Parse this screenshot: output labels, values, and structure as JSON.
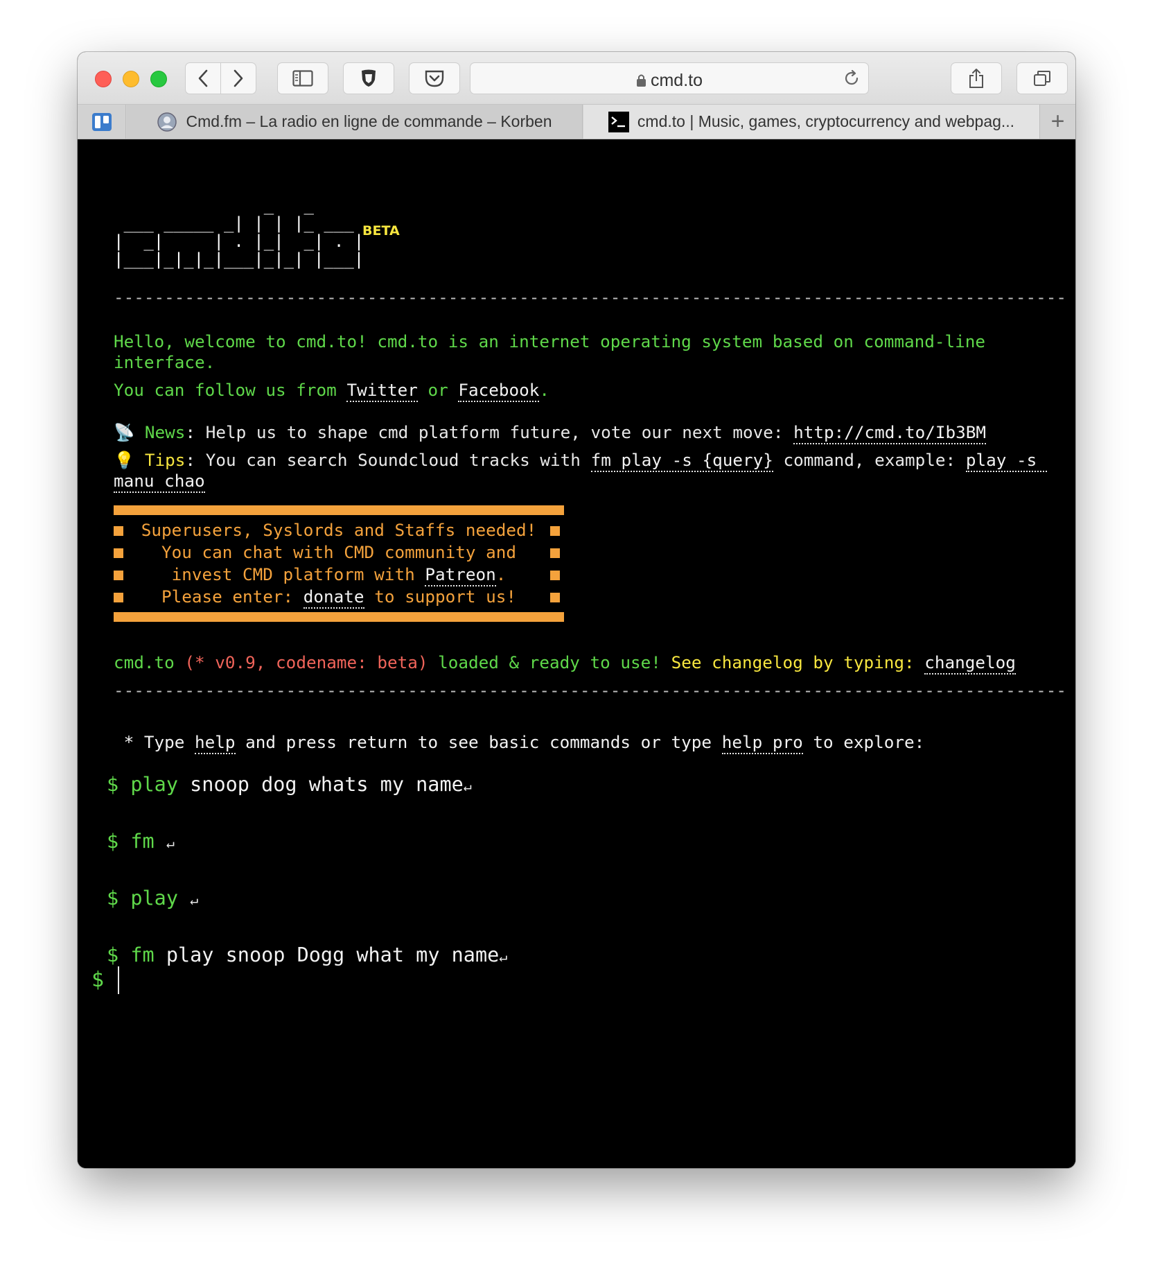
{
  "browser": {
    "url": "cmd.to",
    "tabs": [
      {
        "label": "Cmd.fm – La radio en ligne de commande – Korben"
      },
      {
        "label": "cmd.to | Music, games, cryptocurrency and webpag..."
      }
    ],
    "new_tab_label": "+"
  },
  "terminal": {
    "ascii_logo": [
      "               _   _",
      " ___ _____ _| | | |_ ___",
      "|  _|     | . |_|  _| . |",
      "|___|_|_|_|___|_|_| |___|"
    ],
    "beta_label": "BETA",
    "divider": "----------------------------------------------------------------------------------------------",
    "welcome": {
      "line1": "Hello, welcome to cmd.to! cmd.to is an internet operating system based on command-line",
      "line2": "interface.",
      "follow_prefix": "You can follow us from ",
      "twitter": "Twitter",
      "or": " or ",
      "facebook": "Facebook",
      "period": "."
    },
    "news": {
      "icon": "📡",
      "label": "News",
      "colon": ": ",
      "text": "Help us to shape cmd platform future, vote our next move: ",
      "link": "http://cmd.to/Ib3BM"
    },
    "tips": {
      "icon": "💡",
      "label": "Tips",
      "colon": ": ",
      "text1": "You can search Soundcloud tracks with ",
      "cmd": "fm play -s {query}",
      "text2": " command, example: ",
      "example1": "play -s ",
      "example2": "manu chao"
    },
    "banner": {
      "line1": "Superusers, Syslords and Staffs needed!",
      "line2": "You can chat with CMD community and",
      "line3_prefix": "invest CMD platform with ",
      "patreon": "Patreon",
      "line3_suffix": ".",
      "line4_prefix": "Please enter: ",
      "donate": "donate",
      "line4_suffix": " to support us!"
    },
    "status": {
      "name": "cmd.to ",
      "version": "(* v0.9, codename: beta)",
      "loaded": " loaded & ready to use! ",
      "see": "See changelog by typing: ",
      "changelog": "changelog"
    },
    "help": {
      "prefix": " * Type ",
      "help": "help",
      "middle": " and press return to see basic commands or type ",
      "help_pro": "help pro",
      "suffix": " to explore:"
    },
    "commands": [
      {
        "prompt": "$",
        "cmd": "play",
        "args": " snoop dog whats my name",
        "ret": "↵"
      },
      {
        "prompt": "$",
        "cmd": "fm",
        "args": " ",
        "ret": "↵"
      },
      {
        "prompt": "$",
        "cmd": "play",
        "args": " ",
        "ret": "↵"
      },
      {
        "prompt": "$",
        "cmd": "fm",
        "args": " play snoop Dogg what my name",
        "ret": "↵"
      }
    ],
    "final_prompt": "$"
  }
}
